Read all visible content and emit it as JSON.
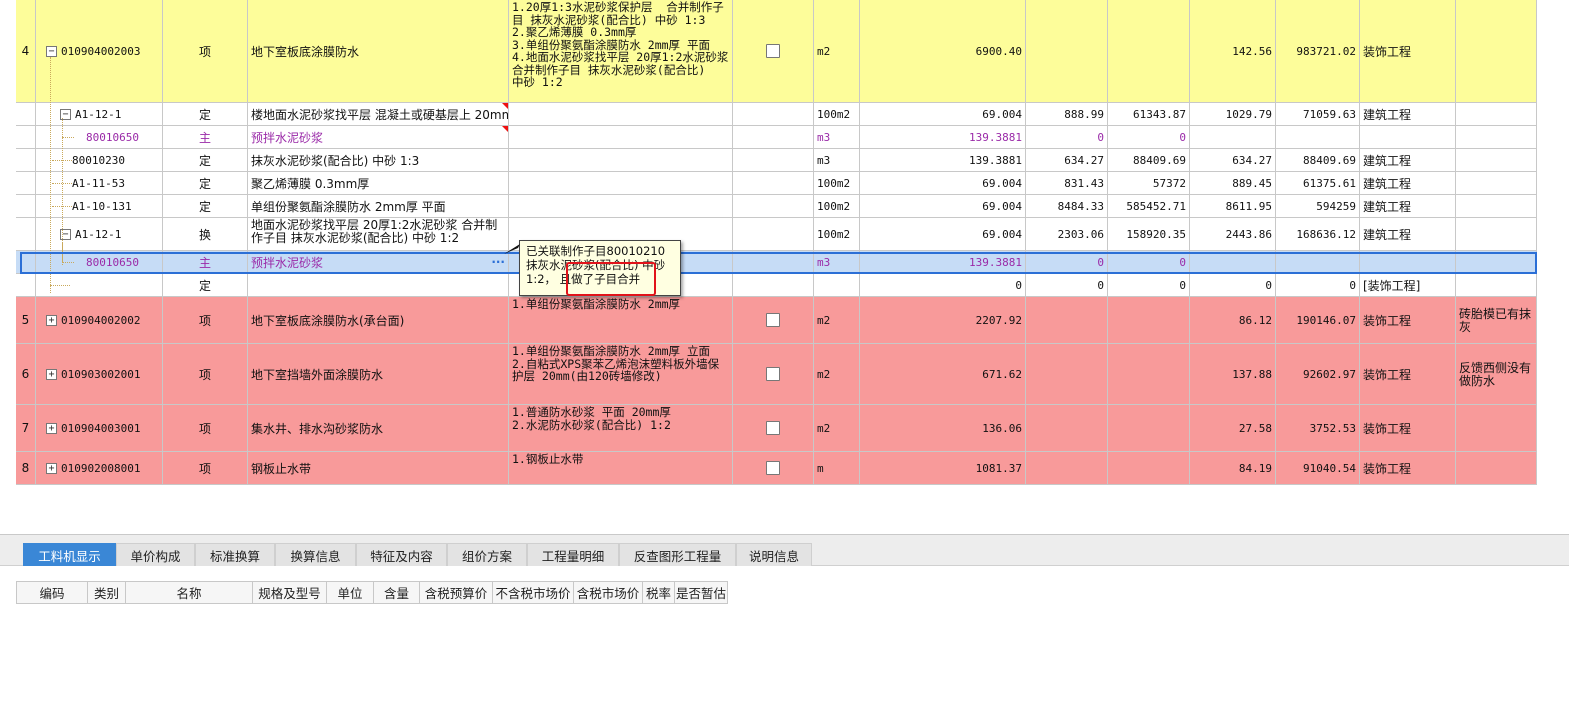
{
  "rows": [
    {
      "kind": "item",
      "color": "yellow",
      "num": "4",
      "code": "010904002003",
      "toggle": "−",
      "type": "项",
      "name": "地下室板底涂膜防水",
      "feature": "1.20厚1:3水泥砂浆保护层  合并制作子目 抹灰水泥砂浆(配合比) 中砂 1:3\n2.聚乙烯薄膜 0.3mm厚\n3.单组份聚氨酯涂膜防水 2mm厚 平面\n4.地面水泥砂浆找平层 20厚1:2水泥砂浆  合并制作子目 抹灰水泥砂浆(配合比)  中砂 1:2",
      "unit": "m2",
      "qty": "6900.40",
      "p1": "",
      "p2": "",
      "p3": "142.56",
      "p4": "983721.02",
      "cat": "装饰工程",
      "note": "",
      "checkbox": true
    },
    {
      "kind": "sub",
      "level": 1,
      "toggle": "−",
      "code": "A1-12-1",
      "type": "定",
      "name": "楼地面水泥砂浆找平层 混凝土或硬基层上 20mm",
      "unit": "100m2",
      "qty": "69.004",
      "p1": "888.99",
      "p2": "61343.87",
      "p3": "1029.79",
      "p4": "71059.63",
      "cat": "建筑工程",
      "mark": true
    },
    {
      "kind": "sub",
      "level": 2,
      "purple": true,
      "code": "80010650",
      "type": "主",
      "name": "预拌水泥砂浆",
      "unit": "m3",
      "qty": "139.3881",
      "p1": "0",
      "p2": "0",
      "p3": "",
      "p4": "",
      "cat": "",
      "mark": true
    },
    {
      "kind": "sub",
      "level": 1,
      "code": "80010230",
      "type": "定",
      "name": "抹灰水泥砂浆(配合比) 中砂 1:3",
      "unit": "m3",
      "qty": "139.3881",
      "p1": "634.27",
      "p2": "88409.69",
      "p3": "634.27",
      "p4": "88409.69",
      "cat": "建筑工程"
    },
    {
      "kind": "sub",
      "level": 1,
      "code": "A1-11-53",
      "type": "定",
      "name": "聚乙烯薄膜 0.3mm厚",
      "unit": "100m2",
      "qty": "69.004",
      "p1": "831.43",
      "p2": "57372",
      "p3": "889.45",
      "p4": "61375.61",
      "cat": "建筑工程"
    },
    {
      "kind": "sub",
      "level": 1,
      "code": "A1-10-131",
      "type": "定",
      "name": "单组份聚氨酯涂膜防水 2mm厚 平面",
      "unit": "100m2",
      "qty": "69.004",
      "p1": "8484.33",
      "p2": "585452.71",
      "p3": "8611.95",
      "p4": "594259",
      "cat": "建筑工程"
    },
    {
      "kind": "sub",
      "level": 1,
      "toggle": "−",
      "code": "A1-12-1",
      "type": "换",
      "name": "地面水泥砂浆找平层 20厚1:2水泥砂浆  合并制作子目 抹灰水泥砂浆(配合比) 中砂 1:2",
      "unit": "100m2",
      "qty": "69.004",
      "p1": "2303.06",
      "p2": "158920.35",
      "p3": "2443.86",
      "p4": "168636.12",
      "cat": "建筑工程"
    },
    {
      "kind": "sub",
      "level": 2,
      "purple": true,
      "selected": true,
      "code": "80010650",
      "type": "主",
      "name": "预拌水泥砂浆",
      "unit": "m3",
      "qty": "139.3881",
      "p1": "0",
      "p2": "0",
      "p3": "",
      "p4": "",
      "cat": "",
      "ellipsis": "···"
    },
    {
      "kind": "sub",
      "level": 1,
      "code": "",
      "type": "定",
      "name": "",
      "unit": "",
      "qty": "0",
      "p1": "0",
      "p2": "0",
      "p3": "0",
      "p4": "0",
      "cat": "[装饰工程]"
    },
    {
      "kind": "item",
      "color": "red",
      "num": "5",
      "code": "010904002002",
      "toggle": "+",
      "type": "项",
      "name": "地下室板底涂膜防水(承台面)",
      "feature": "1.单组份聚氨酯涂膜防水 2mm厚",
      "unit": "m2",
      "qty": "2207.92",
      "p1": "",
      "p2": "",
      "p3": "86.12",
      "p4": "190146.07",
      "cat": "装饰工程",
      "note": "砖胎模已有抹灰",
      "checkbox": true
    },
    {
      "kind": "item",
      "color": "red",
      "num": "6",
      "code": "010903002001",
      "toggle": "+",
      "type": "项",
      "name": "地下室挡墙外面涂膜防水",
      "feature": "1.单组份聚氨酯涂膜防水 2mm厚 立面\n2.自粘式XPS聚苯乙烯泡沫塑料板外墙保护层 20mm(由120砖墙修改)",
      "unit": "m2",
      "qty": "671.62",
      "p1": "",
      "p2": "",
      "p3": "137.88",
      "p4": "92602.97",
      "cat": "装饰工程",
      "note": "反馈西侧没有做防水",
      "checkbox": true
    },
    {
      "kind": "item",
      "color": "red",
      "num": "7",
      "code": "010904003001",
      "toggle": "+",
      "type": "项",
      "name": "集水井、排水沟砂浆防水",
      "feature": "1.普通防水砂浆 平面 20mm厚\n2.水泥防水砂浆(配合比) 1:2",
      "unit": "m2",
      "qty": "136.06",
      "p1": "",
      "p2": "",
      "p3": "27.58",
      "p4": "3752.53",
      "cat": "装饰工程",
      "note": "",
      "checkbox": true
    },
    {
      "kind": "item",
      "color": "red",
      "num": "8",
      "code": "010902008001",
      "toggle": "+",
      "type": "项",
      "name": "钢板止水带",
      "feature": "1.钢板止水带",
      "unit": "m",
      "qty": "1081.37",
      "p1": "",
      "p2": "",
      "p3": "84.19",
      "p4": "91040.54",
      "cat": "装饰工程",
      "note": "",
      "checkbox": true
    }
  ],
  "tooltip": {
    "text": "已关联制作子目80010210 抹灰水泥砂浆(配合比) 中砂 1:2， 且做了子目合并"
  },
  "tabs": [
    {
      "label": "工料机显示",
      "active": true
    },
    {
      "label": "单价构成"
    },
    {
      "label": "标准换算"
    },
    {
      "label": "换算信息"
    },
    {
      "label": "特征及内容"
    },
    {
      "label": "组价方案"
    },
    {
      "label": "工程量明细"
    },
    {
      "label": "反查图形工程量"
    },
    {
      "label": "说明信息"
    }
  ],
  "columns": [
    "编码",
    "类别",
    "名称",
    "规格及型号",
    "单位",
    "含量",
    "含税预算价",
    "不含税市场价",
    "含税市场价",
    "税率",
    "是否暂估"
  ],
  "colors": {
    "yellow": "#fdfd9a",
    "red": "#f89a9a",
    "selected": "#c6dcf6",
    "purple": "#9a2aa8",
    "tab_active": "#3a87d6",
    "highlight": "#e1131a"
  }
}
